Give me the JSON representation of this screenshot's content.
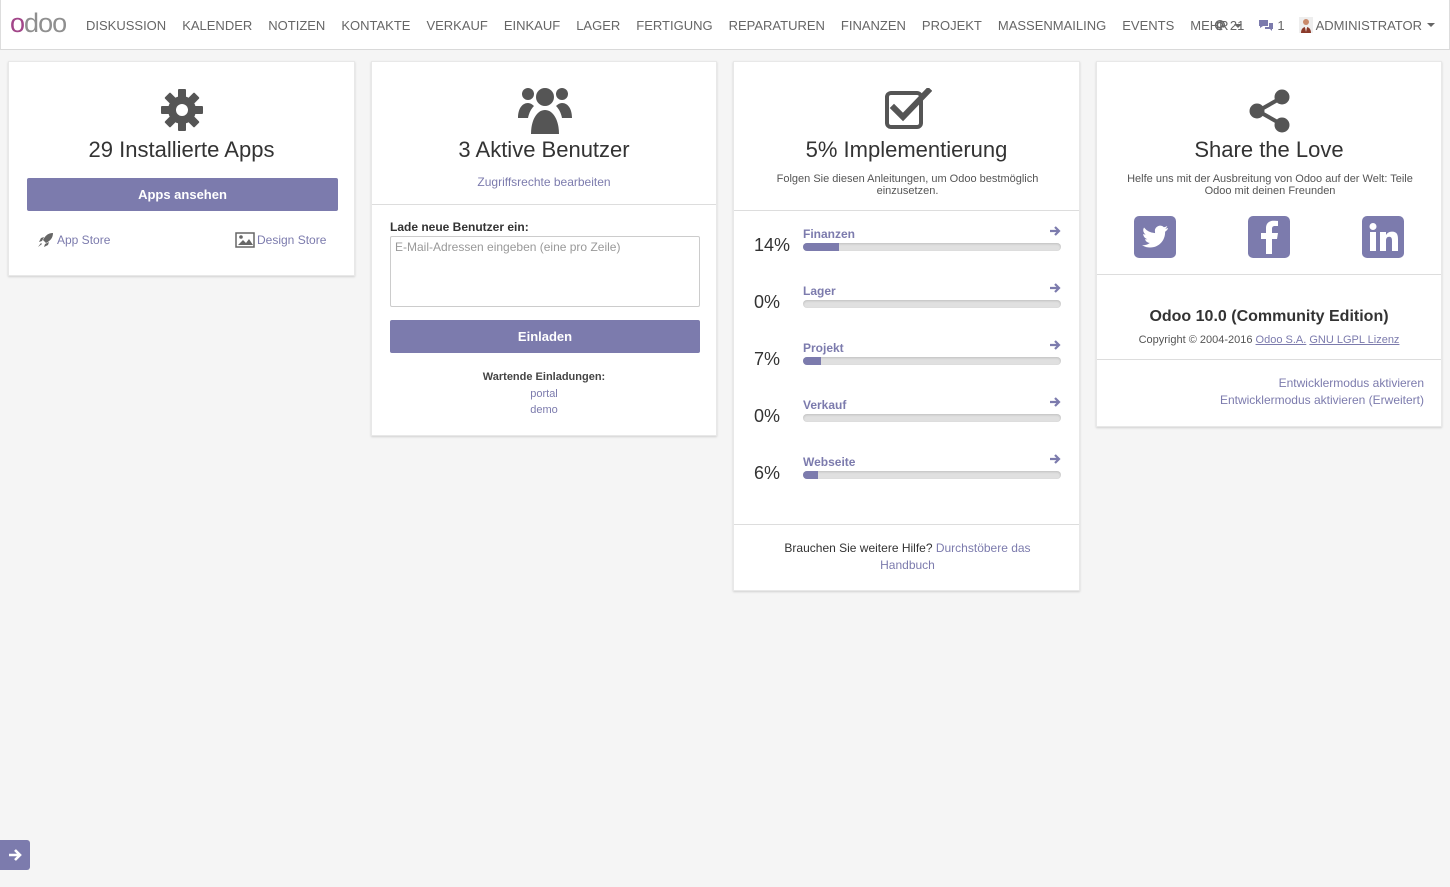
{
  "brand": {
    "logo_letters": [
      "o",
      "d",
      "o",
      "o"
    ]
  },
  "nav": {
    "items": [
      "DISKUSSION",
      "KALENDER",
      "NOTIZEN",
      "KONTAKTE",
      "VERKAUF",
      "EINKAUF",
      "LAGER",
      "FERTIGUNG",
      "REPARATUREN",
      "FINANZEN",
      "PROJEKT",
      "MASSENMAILING",
      "EVENTS"
    ],
    "more": "MEHR",
    "mentions_count": "21",
    "messages_count": "1",
    "user": "ADMINISTRATOR"
  },
  "apps_card": {
    "title": "29 Installierte Apps",
    "button": "Apps ansehen",
    "app_store": "App Store",
    "design_store": "Design Store"
  },
  "users_card": {
    "title": "3 Aktive Benutzer",
    "access_link": "Zugriffsrechte bearbeiten",
    "invite_label": "Lade neue Benutzer ein:",
    "invite_placeholder": "E-Mail-Adressen eingeben (eine pro Zeile)",
    "invite_button": "Einladen",
    "pending_label": "Wartende Einladungen:",
    "pending": [
      "portal",
      "demo"
    ]
  },
  "impl_card": {
    "title": "5% Implementierung",
    "subtitle": "Folgen Sie diesen Anleitungen, um Odoo bestmöglich einzusetzen.",
    "items": [
      {
        "pct": "14%",
        "name": "Finanzen",
        "progress": 14
      },
      {
        "pct": "0%",
        "name": "Lager",
        "progress": 0
      },
      {
        "pct": "7%",
        "name": "Projekt",
        "progress": 7
      },
      {
        "pct": "0%",
        "name": "Verkauf",
        "progress": 0
      },
      {
        "pct": "6%",
        "name": "Webseite",
        "progress": 6
      }
    ],
    "help_text": "Brauchen Sie weitere Hilfe?",
    "help_link": "Durchstöbere das Handbuch"
  },
  "share_card": {
    "title": "Share the Love",
    "subtitle": "Helfe uns mit der Ausbreitung von Odoo auf der Welt: Teile Odoo mit deinen Freunden",
    "version": "Odoo 10.0 (Community Edition)",
    "copyright": "Copyright © 2004-2016",
    "company_link": "Odoo S.A.",
    "license_link": "GNU LGPL Lizenz",
    "dev_mode": "Entwicklermodus aktivieren",
    "dev_mode_assets": "Entwicklermodus aktivieren (Erweitert)"
  },
  "colors": {
    "primary": "#7c7bad",
    "logo_accent": "#a24689",
    "background": "#f5f5f5"
  }
}
